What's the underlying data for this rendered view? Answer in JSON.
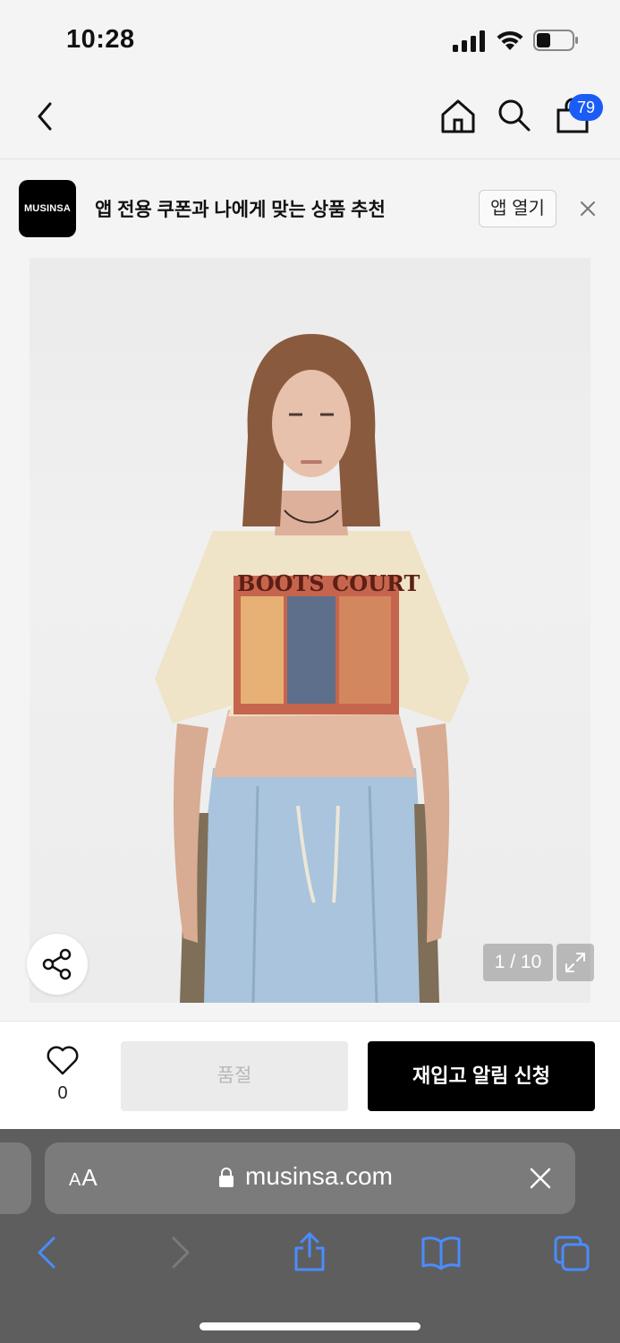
{
  "status_bar": {
    "time": "10:28"
  },
  "nav": {
    "cart_count": "79"
  },
  "app_banner": {
    "logo_text": "MUSINSA",
    "message": "앱 전용 쿠폰과 나에게 맞는 상품 추천",
    "open_label": "앱 열기"
  },
  "product": {
    "image_counter": "1 / 10",
    "tshirt_print": "BOOTS COURT",
    "like_count": "0",
    "soldout_label": "품절",
    "restock_label": "재입고 알림 신청"
  },
  "browser": {
    "text_size_label_small": "A",
    "text_size_label_large": "A",
    "url": "musinsa.com"
  },
  "colors": {
    "badge": "#1b5cf7",
    "primary_button": "#000000",
    "disabled_button": "#ebebeb",
    "browser_link": "#4a8cff"
  }
}
